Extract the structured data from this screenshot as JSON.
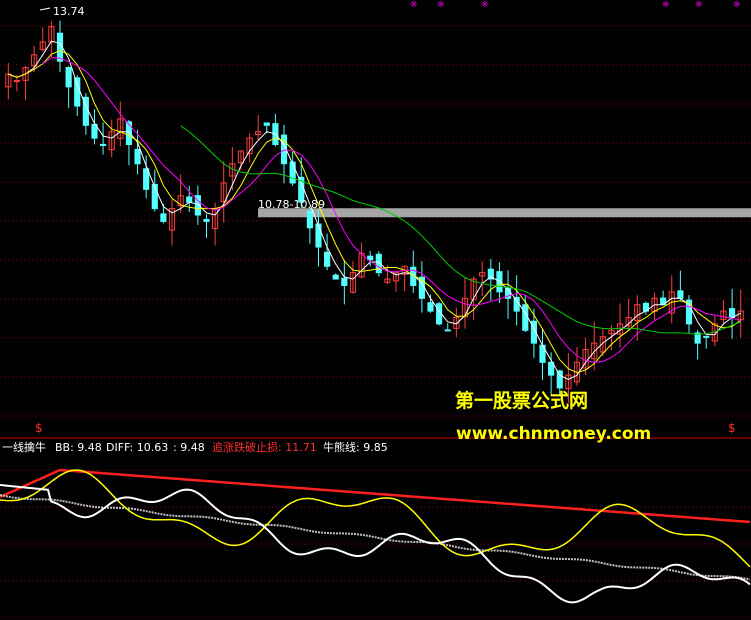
{
  "colors": {
    "background": "#000000",
    "grid": "#8b0000",
    "divider": "#d40000",
    "candle_up": "#ff4040",
    "candle_down": "#54ffff",
    "ma_short": "#ffffff",
    "ma_mid": "#ffff00",
    "ma_magenta": "#ff00ff",
    "ma_long": "#00cc00",
    "band": "#a6a6a6",
    "diff_line": "#ffff00",
    "stop_line": "#ff2020",
    "bull_line": "#ffffff",
    "signal_line": "#c0c0c0",
    "watermark_text": "#ffff00",
    "marker": "#ff00ff"
  },
  "main_panel": {
    "high_label": "13.74",
    "band_label": "10.78-10.89",
    "watermark_cn": "第一股票公式网",
    "watermark_url": "www.chnmoney.com",
    "marker_glyph": "$"
  },
  "indicator_bar": {
    "name": "一线擒牛",
    "bb": "BB: 9.48",
    "diff": "DIFF: 10.63",
    "diff_extra": ": 9.48",
    "stop": "追涨跌破止损: 11.71",
    "bull": "牛熊线: 9.85"
  },
  "chart_data": [
    {
      "type": "candlestick",
      "title": "",
      "ylim": [
        7.6,
        14.0
      ],
      "high_point": 13.74,
      "band": [
        10.78,
        10.89
      ],
      "close_series": [
        13.0,
        12.9,
        13.1,
        13.3,
        13.5,
        13.74,
        13.2,
        12.8,
        12.5,
        12.2,
        12.0,
        11.9,
        12.1,
        12.3,
        11.9,
        11.6,
        11.2,
        10.9,
        10.7,
        10.9,
        11.1,
        11.0,
        10.8,
        10.7,
        10.9,
        11.3,
        11.6,
        11.8,
        12.0,
        12.1,
        12.2,
        11.9,
        11.6,
        11.3,
        11.0,
        10.6,
        10.3,
        10.0,
        9.8,
        9.7,
        9.9,
        10.2,
        10.1,
        9.9,
        9.8,
        9.9,
        10.0,
        9.7,
        9.5,
        9.3,
        9.1,
        9.0,
        9.2,
        9.5,
        9.8,
        9.9,
        9.8,
        9.6,
        9.5,
        9.3,
        9.0,
        8.8,
        8.5,
        8.3,
        8.1,
        8.3,
        8.5,
        8.7,
        8.8,
        8.9,
        9.0,
        9.1,
        9.2,
        9.4,
        9.3,
        9.5,
        9.4,
        9.6,
        9.5,
        9.1,
        8.8,
        8.9,
        9.1,
        9.3,
        9.2,
        9.3
      ]
    },
    {
      "type": "line",
      "title": "",
      "series": [
        {
          "name": "BB",
          "last": 9.48
        },
        {
          "name": "DIFF",
          "last": 10.63
        },
        {
          "name": "追涨跌破止损",
          "last": 11.71
        },
        {
          "name": "牛熊线",
          "last": 9.85
        }
      ]
    }
  ]
}
